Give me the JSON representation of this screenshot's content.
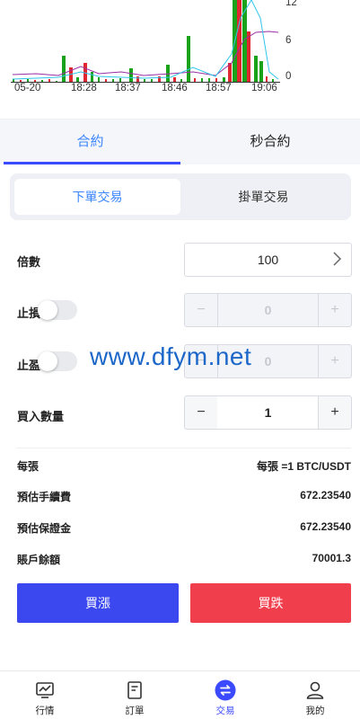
{
  "chart": {
    "x_labels": [
      "05-20",
      "18:28",
      "18:37",
      "18:46",
      "18:57",
      "19:06"
    ],
    "y_labels": [
      "12",
      "6",
      "0"
    ],
    "colors": {
      "up": "#1aa31a",
      "down": "#e0262f",
      "ma_cyan": "#2fc6e8",
      "ma_purple": "#9a2fa5"
    }
  },
  "tabs": [
    {
      "label": "合約",
      "active": true
    },
    {
      "label": "秒合約",
      "active": false
    }
  ],
  "order_types": [
    {
      "label": "下單交易",
      "active": true
    },
    {
      "label": "掛單交易",
      "active": false
    }
  ],
  "form": {
    "leverage": {
      "label": "倍數",
      "value": "100"
    },
    "stop_loss": {
      "label": "止損",
      "value": "0",
      "minus": "−",
      "plus": "+"
    },
    "take_profit": {
      "label": "止盈",
      "value": "0",
      "minus": "−",
      "plus": "+"
    },
    "quantity": {
      "label": "買入數量",
      "value": "1",
      "minus": "−",
      "plus": "+"
    }
  },
  "info": [
    {
      "label": "每張",
      "value": "每張 =1 BTC/USDT"
    },
    {
      "label": "預估手續費",
      "value": "672.23540"
    },
    {
      "label": "預估保證金",
      "value": "672.23540"
    },
    {
      "label": "賬戶餘額",
      "value": "70001.3"
    }
  ],
  "actions": {
    "buy_up": {
      "label": "買漲",
      "color": "#3b47ef"
    },
    "buy_down": {
      "label": "買跌",
      "color": "#f13e4d"
    }
  },
  "watermark": "www.dfym.net",
  "bottom_nav": [
    {
      "label": "行情",
      "icon": "market-chart-icon",
      "active": false
    },
    {
      "label": "訂單",
      "icon": "order-document-icon",
      "active": false
    },
    {
      "label": "交易",
      "icon": "trade-exchange-icon",
      "active": true
    },
    {
      "label": "我的",
      "icon": "user-profile-icon",
      "active": false
    }
  ]
}
